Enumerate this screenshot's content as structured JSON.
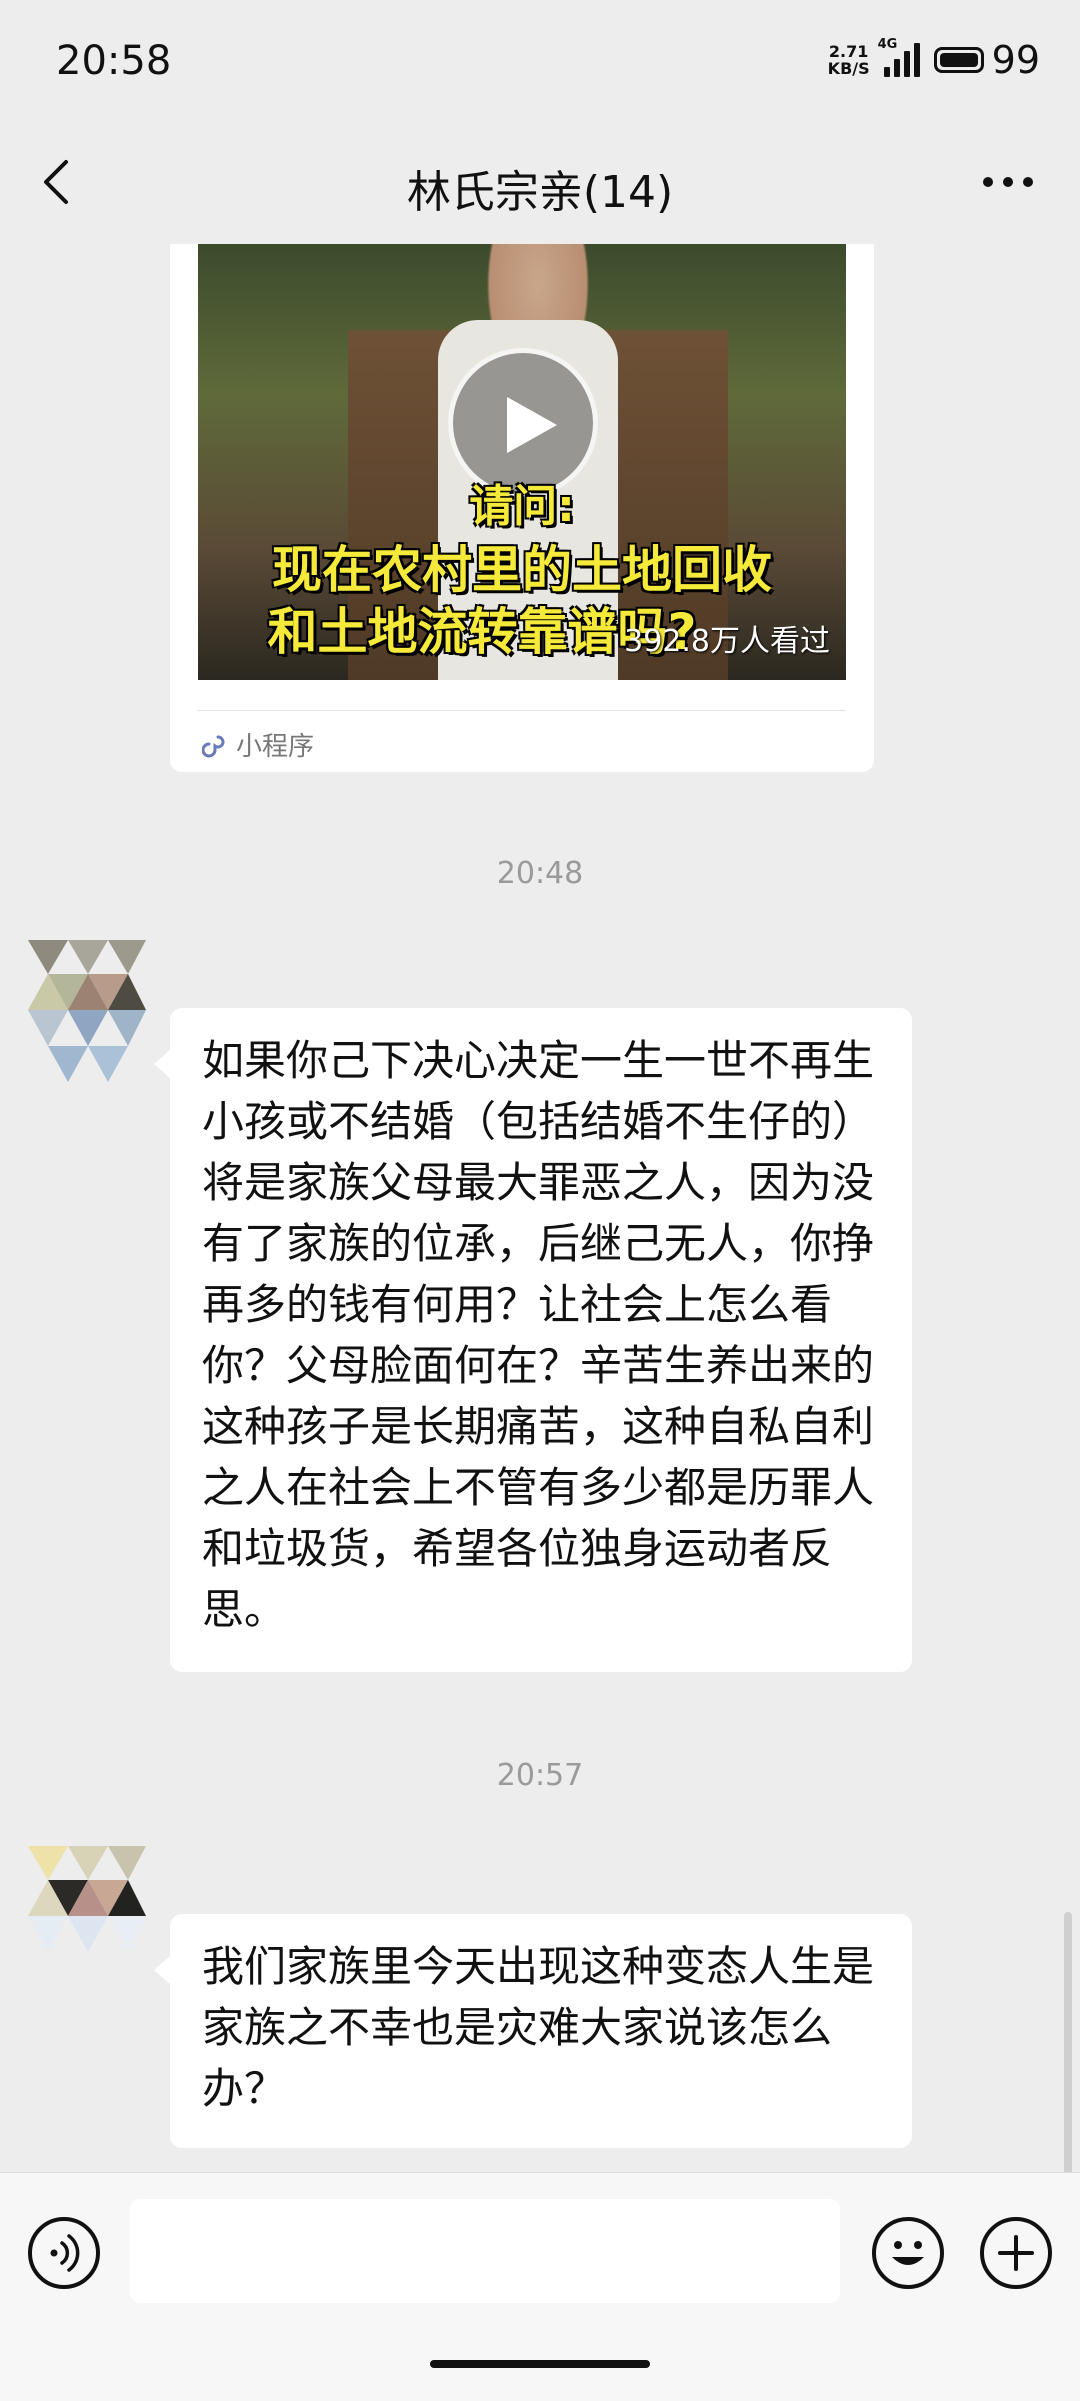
{
  "status_bar": {
    "time": "20:58",
    "net_speed_value": "2.71",
    "net_speed_unit": "KB/S",
    "network_type": "4G",
    "battery": "99"
  },
  "header": {
    "title": "林氏宗亲(14)"
  },
  "miniapp_card": {
    "caption_line1": "请问:",
    "caption_line2": "现在农村里的土地回收",
    "caption_line3": "和土地流转靠谱吗?",
    "view_count": "392.8万人看过",
    "source_label": "小程序"
  },
  "messages": [
    {
      "timestamp": "20:48",
      "text": "如果你己下决心决定一生一世不再生小孩或不结婚（包括结婚不生仔的）将是家族父母最大罪恶之人，因为没有了家族的位承，后继己无人，你挣再多的钱有何用？让社会上怎么看你？父母脸面何在？辛苦生养出来的这种孩子是长期痛苦，这种自私自利之人在社会上不管有多少都是历罪人和垃圾货，希望各位独身运动者反思。"
    },
    {
      "timestamp": "20:57",
      "text": "我们家族里今天出现这种变态人生是家族之不幸也是灾难大家说该怎么办？"
    }
  ],
  "input": {
    "value": ""
  }
}
